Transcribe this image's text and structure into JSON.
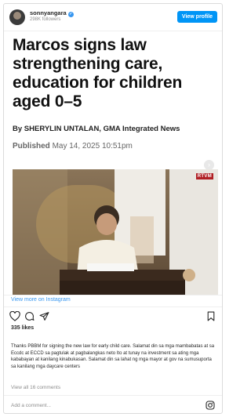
{
  "header": {
    "username": "sonnyangara",
    "followers": "298K followers",
    "view_profile_label": "View profile"
  },
  "media": {
    "headline": "Marcos signs law strengthening care, education for children aged 0–5",
    "byline": "By SHERYLIN UNTALAN, GMA Integrated News",
    "published_label": "Published",
    "published_date": "May 14, 2025 10:51pm",
    "tv_logo_text": "RTVM"
  },
  "actions": {
    "view_more": "View more on Instagram",
    "likes": "335 likes"
  },
  "caption": {
    "text": "Thanks PBBM for signing the new law for early child care. Salamat din sa mga mambabatas at sa Eccdc at ECCD sa pagtulak at pagbalangkas neto           Ito at tunay na investment sa ating mga kababayan at kanilang kinabukasan. Salamat din sa lahat ng mga mayor at gov na sumusuporta sa kanilang mga daycare centers"
  },
  "comments": {
    "view_all": "View all 16 comments",
    "add_placeholder": "Add a comment..."
  },
  "icons": {
    "heart": "heart-icon",
    "comment": "comment-icon",
    "share": "share-icon",
    "bookmark": "bookmark-icon",
    "instagram": "instagram-icon",
    "verified": "verified-badge-icon",
    "next": "chevron-right-icon"
  },
  "colors": {
    "accent": "#0095f6",
    "link": "#3897f0",
    "muted": "#8e8e8e"
  }
}
